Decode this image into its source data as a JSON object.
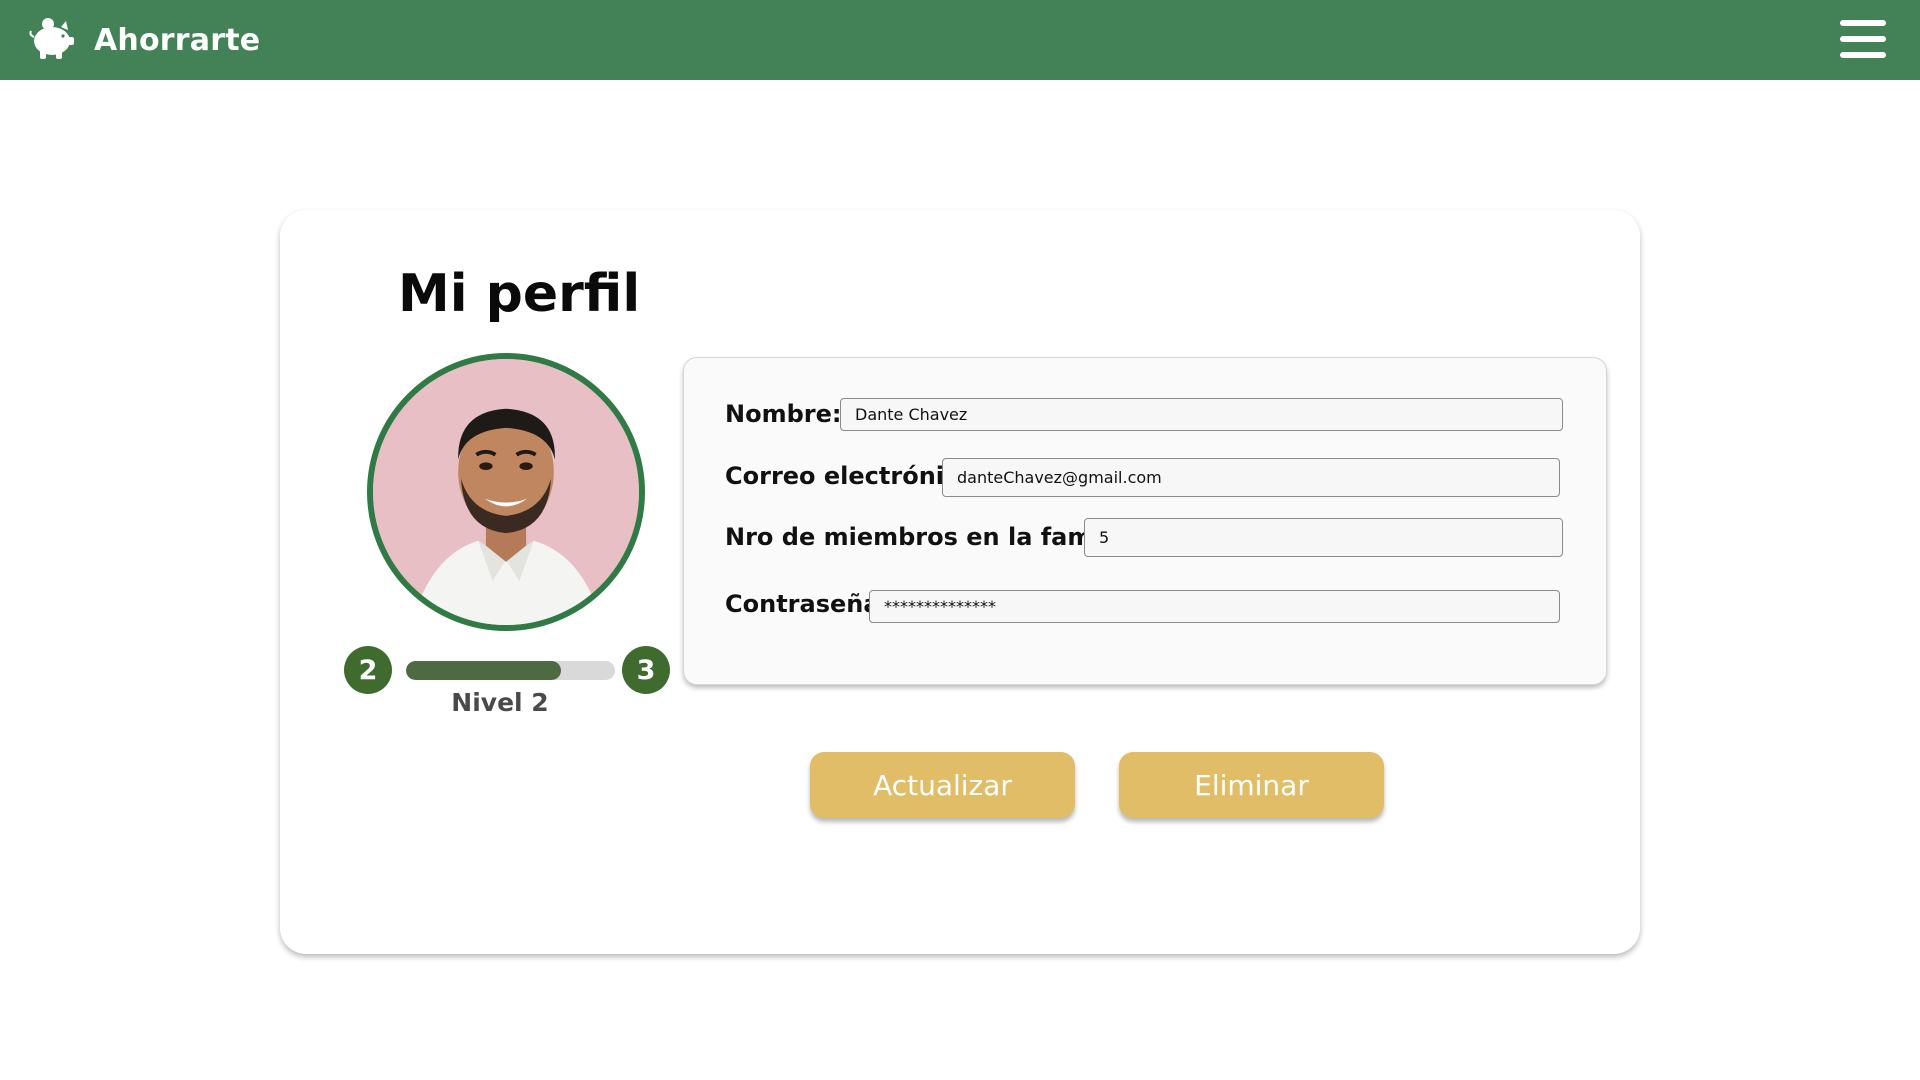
{
  "header": {
    "app_name": "Ahorrarte",
    "logo_icon": "piggy-bank-icon",
    "menu_icon": "hamburger-menu-icon",
    "background_color": "#438156"
  },
  "profile": {
    "title": "Mi perfil",
    "current_level": "2",
    "next_level": "3",
    "level_label": "Nivel 2",
    "level_progress_fraction": 0.74
  },
  "form": {
    "nombre_label": "Nombre:",
    "nombre_value": "Dante Chavez",
    "correo_label": "Correo electrónico:",
    "correo_value": "danteChavez@gmail.com",
    "miembros_label": "Nro de miembros en la familia:",
    "miembros_value": "5",
    "password_label": "Contraseña:",
    "password_value": "**************"
  },
  "actions": {
    "update_label": "Actualizar",
    "delete_label": "Eliminar",
    "button_color": "#e2bd67"
  }
}
